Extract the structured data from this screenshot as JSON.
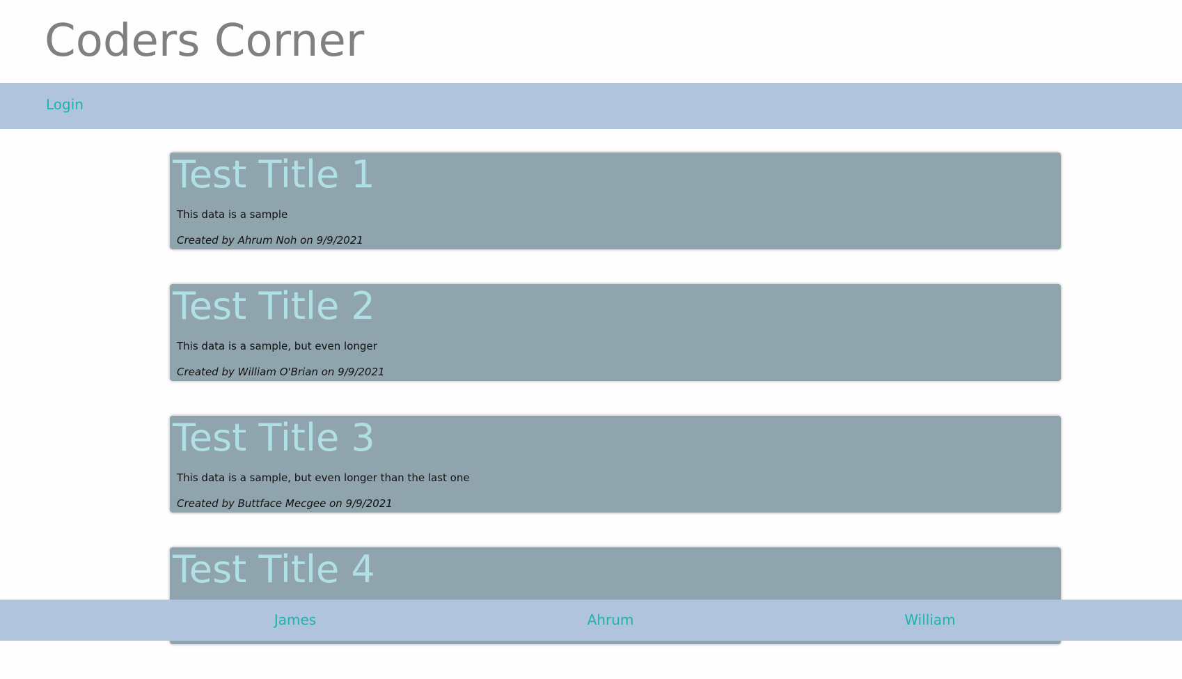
{
  "header": {
    "title": "Coders Corner"
  },
  "nav": {
    "login": "Login"
  },
  "posts": [
    {
      "title": "Test Title 1",
      "body": "This data is a sample",
      "meta": "Created by Ahrum Noh on 9/9/2021"
    },
    {
      "title": "Test Title 2",
      "body": "This data is a sample, but even longer",
      "meta": "Created by William O'Brian on 9/9/2021"
    },
    {
      "title": "Test Title 3",
      "body": "This data is a sample, but even longer than the last one",
      "meta": "Created by Buttface Mecgee on 9/9/2021"
    },
    {
      "title": "Test Title 4"
    }
  ],
  "footer": {
    "links": [
      "James",
      "Ahrum",
      "William"
    ]
  },
  "colors": {
    "nav_bg": "#b0c4de",
    "link": "#20b2aa",
    "card_bg": "#8fa4ad",
    "card_title": "#b0e0e6"
  }
}
